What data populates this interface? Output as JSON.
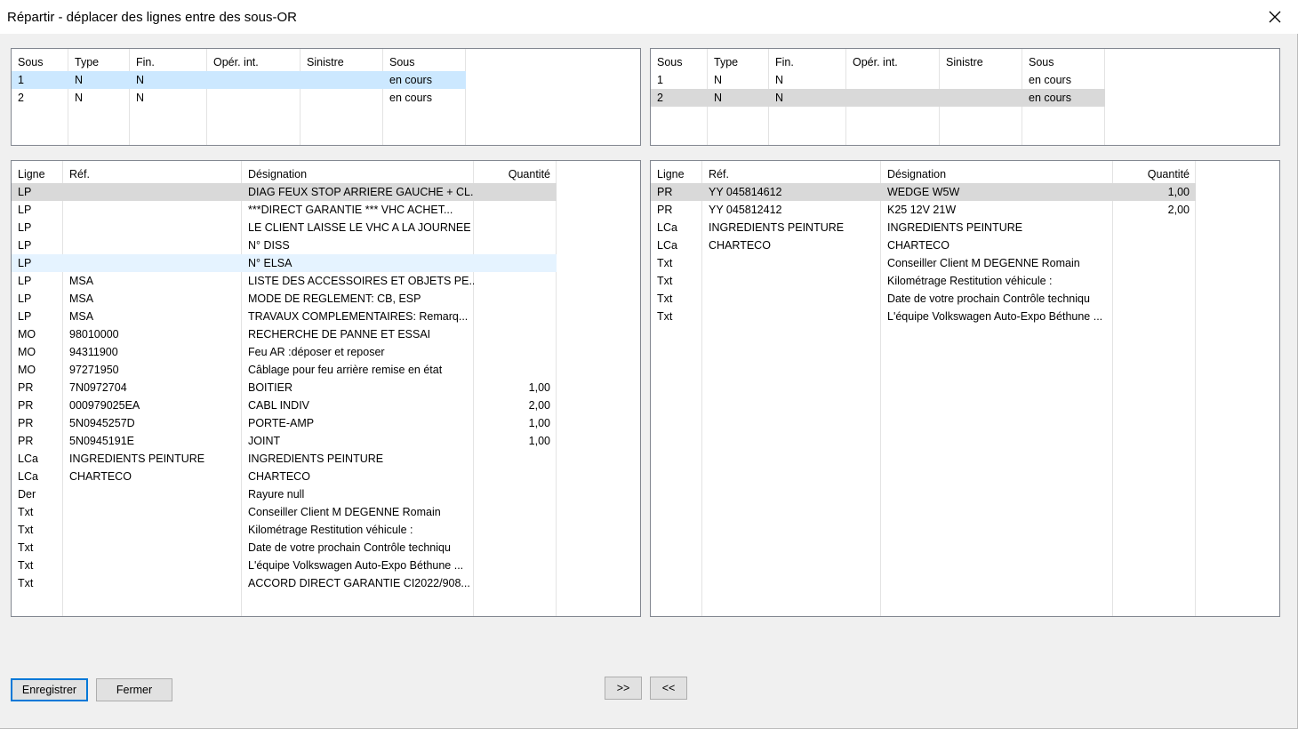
{
  "window": {
    "title": "Répartir - déplacer des lignes entre des sous-OR"
  },
  "sous_headers": [
    "Sous",
    "Type",
    "Fin.",
    "Opér. int.",
    "Sinistre",
    "Sous"
  ],
  "sous_left": [
    [
      "1",
      "N",
      "N",
      "",
      "",
      "en cours"
    ],
    [
      "2",
      "N",
      "N",
      "",
      "",
      "en cours"
    ]
  ],
  "sous_right": [
    [
      "1",
      "N",
      "N",
      "",
      "",
      "en cours"
    ],
    [
      "2",
      "N",
      "N",
      "",
      "",
      "en cours"
    ]
  ],
  "lines_headers": [
    "Ligne",
    "Réf.",
    "Désignation",
    "Quantité"
  ],
  "lines_left": [
    [
      "LP",
      "",
      "DIAG FEUX STOP ARRIERE GAUCHE + CL...",
      ""
    ],
    [
      "LP",
      "",
      "***DIRECT GARANTIE *** VHC ACHET...",
      ""
    ],
    [
      "LP",
      "",
      "LE CLIENT LAISSE LE VHC A LA JOURNEE",
      ""
    ],
    [
      "LP",
      "",
      "N° DISS",
      ""
    ],
    [
      "LP",
      "",
      "N° ELSA",
      ""
    ],
    [
      "LP",
      "MSA",
      "LISTE DES ACCESSOIRES ET OBJETS PE...",
      ""
    ],
    [
      "LP",
      "MSA",
      "MODE DE REGLEMENT: CB, ESP",
      ""
    ],
    [
      "LP",
      "MSA",
      "TRAVAUX COMPLEMENTAIRES: Remarq...",
      ""
    ],
    [
      "MO",
      "98010000",
      "RECHERCHE DE PANNE ET ESSAI",
      ""
    ],
    [
      "MO",
      "94311900",
      "Feu AR :déposer et reposer",
      ""
    ],
    [
      "MO",
      "97271950",
      "Câblage pour feu arrière remise en état",
      ""
    ],
    [
      "PR",
      "7N0972704",
      "BOITIER",
      "1,00"
    ],
    [
      "PR",
      "000979025EA",
      "CABL INDIV",
      "2,00"
    ],
    [
      "PR",
      "5N0945257D",
      "PORTE-AMP",
      "1,00"
    ],
    [
      "PR",
      "5N0945191E",
      "JOINT",
      "1,00"
    ],
    [
      "LCa",
      "INGREDIENTS PEINTURE",
      "INGREDIENTS PEINTURE",
      ""
    ],
    [
      "LCa",
      "CHARTECO",
      "CHARTECO",
      ""
    ],
    [
      "Der",
      "",
      "Rayure null",
      ""
    ],
    [
      "Txt",
      "",
      "Conseiller Client M DEGENNE Romain",
      ""
    ],
    [
      "Txt",
      "",
      "Kilométrage Restitution véhicule :",
      ""
    ],
    [
      "Txt",
      "",
      "Date de votre prochain Contrôle techniqu",
      ""
    ],
    [
      "Txt",
      "",
      "L'équipe Volkswagen Auto-Expo Béthune ...",
      ""
    ],
    [
      "Txt",
      "",
      "ACCORD DIRECT GARANTIE CI2022/908...",
      ""
    ]
  ],
  "lines_right": [
    [
      "PR",
      "YY 045814612",
      "WEDGE W5W",
      "1,00"
    ],
    [
      "PR",
      "YY 045812412",
      "K25 12V 21W",
      "2,00"
    ],
    [
      "LCa",
      "INGREDIENTS PEINTURE",
      "INGREDIENTS PEINTURE",
      ""
    ],
    [
      "LCa",
      "CHARTECO",
      "CHARTECO",
      ""
    ],
    [
      "Txt",
      "",
      "Conseiller Client M DEGENNE Romain",
      ""
    ],
    [
      "Txt",
      "",
      "Kilométrage Restitution véhicule :",
      ""
    ],
    [
      "Txt",
      "",
      "Date de votre prochain Contrôle techniqu",
      ""
    ],
    [
      "Txt",
      "",
      "L'équipe Volkswagen Auto-Expo Béthune ...",
      ""
    ]
  ],
  "buttons": {
    "save": "Enregistrer",
    "close": "Fermer",
    "move_right": ">>",
    "move_left": "<<"
  },
  "colors": {
    "selected_focus": "#cce8ff",
    "selected_inactive": "#d9d9d9",
    "hover": "#e5f3ff",
    "default_button_border": "#0078d7"
  }
}
